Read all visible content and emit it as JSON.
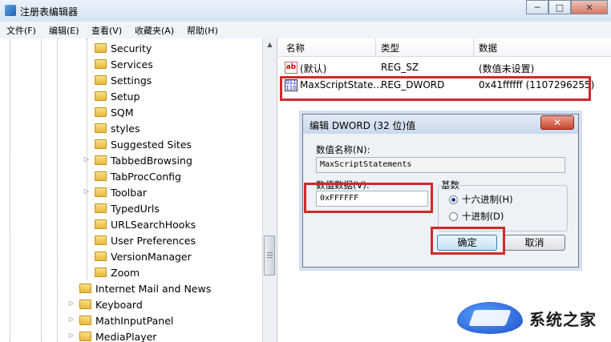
{
  "window": {
    "title": "注册表编辑器",
    "minimize_label": "─",
    "maximize_label": "□",
    "close_label": "✕"
  },
  "menu": [
    "文件(F)",
    "编辑(E)",
    "查看(V)",
    "收藏夹(A)",
    "帮助(H)"
  ],
  "tree": {
    "children_of_current": [
      {
        "label": "Security",
        "expandable": false
      },
      {
        "label": "Services",
        "expandable": false
      },
      {
        "label": "Settings",
        "expandable": false
      },
      {
        "label": "Setup",
        "expandable": false
      },
      {
        "label": "SQM",
        "expandable": false
      },
      {
        "label": "styles",
        "expandable": false,
        "selected": true
      },
      {
        "label": "Suggested Sites",
        "expandable": false
      },
      {
        "label": "TabbedBrowsing",
        "expandable": true
      },
      {
        "label": "TabProcConfig",
        "expandable": false
      },
      {
        "label": "Toolbar",
        "expandable": true
      },
      {
        "label": "TypedUrls",
        "expandable": false
      },
      {
        "label": "URLSearchHooks",
        "expandable": false
      },
      {
        "label": "User Preferences",
        "expandable": false
      },
      {
        "label": "VersionManager",
        "expandable": false
      },
      {
        "label": "Zoom",
        "expandable": false
      }
    ],
    "siblings": [
      {
        "label": "Internet Mail and News",
        "expandable": false
      },
      {
        "label": "Keyboard",
        "expandable": true
      },
      {
        "label": "MathInputPanel",
        "expandable": true
      },
      {
        "label": "MediaPlayer",
        "expandable": true
      }
    ]
  },
  "list": {
    "headers": {
      "name": "名称",
      "type": "类型",
      "data": "数据"
    },
    "rows": [
      {
        "icon": "string-value-icon",
        "icon_text": "ab",
        "name": "(默认)",
        "type": "REG_SZ",
        "data": "(数值未设置)"
      },
      {
        "icon": "binary-value-icon",
        "icon_text": "011 110",
        "name": "MaxScriptState...",
        "type": "REG_DWORD",
        "data": "0x41ffffff (1107296255)"
      }
    ]
  },
  "dialog": {
    "title": "编辑 DWORD (32 位)值",
    "close_label": "✕",
    "value_name_label": "数值名称(N):",
    "value_name": "MaxScriptStatements",
    "value_data_label": "数值数据(V):",
    "value_data": "0xFFFFFF",
    "base_label": "基数",
    "radios": [
      {
        "label": "十六进制(H)",
        "checked": true
      },
      {
        "label": "十进制(D)",
        "checked": false
      }
    ],
    "ok_label": "确定",
    "cancel_label": "取消"
  },
  "watermark": {
    "text": "系统之家"
  },
  "colors": {
    "highlight": "#cf2a2a",
    "accent": "#3c7fb1"
  }
}
